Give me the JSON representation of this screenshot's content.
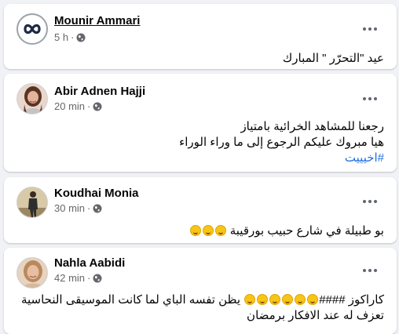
{
  "posts": [
    {
      "author": "Mounir Ammari",
      "time": "5 h",
      "dot": "·",
      "text_lines": [
        "عيد \"التحرّر \" المبارك"
      ]
    },
    {
      "author": "Abir Adnen Hajji",
      "time": "20 min",
      "dot": "·",
      "text_lines": [
        "رجعنا للمشاهد الخرائية بامتياز",
        "هيا مبروك عليكم الرجوع إلى ما وراء الوراء"
      ],
      "hashtag": "#اخيييت"
    },
    {
      "author": "Koudhai Monia",
      "time": "30 min",
      "dot": "·",
      "text_lines": [
        "بو طبيلة في شارع حبيب بورقيبة"
      ]
    },
    {
      "author": "Nahla Aabidi",
      "time": "42 min",
      "dot": "·",
      "text_lines": [
        "كاراكوز ####",
        "يظن تفسه الباي لما كانت الموسيقى النحاسية",
        "تعزف له عند الافكار برمضان"
      ]
    }
  ],
  "icons": {
    "globe": "globe-icon",
    "more": "more-options-icon",
    "emoji": "rolling-laughing-emoji"
  },
  "colors": {
    "background": "#f0f2f5",
    "card": "#ffffff",
    "meta": "#65676b",
    "link": "#216fdb"
  }
}
